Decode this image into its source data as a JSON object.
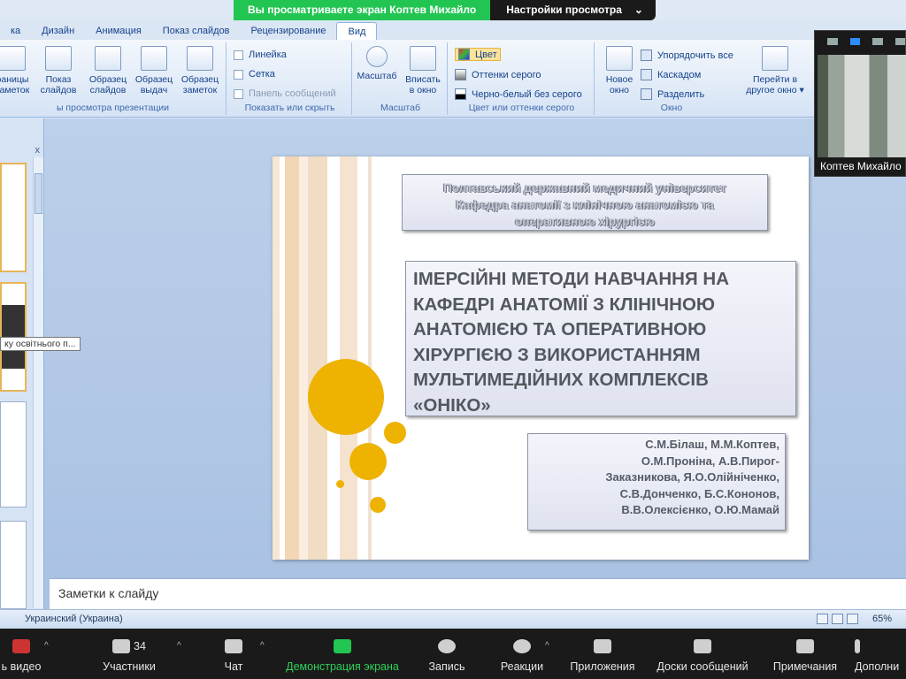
{
  "banner": {
    "message": "Вы просматриваете экран Коптев Михайло",
    "view_options": "Настройки просмотра",
    "view_options_chevron": "⌄"
  },
  "ribbon_tabs": [
    "ка",
    "Дизайн",
    "Анимация",
    "Показ слайдов",
    "Рецензирование",
    "Вид"
  ],
  "ribbon": {
    "presentation_views": {
      "buttons": [
        "раницы\nзаметок",
        "Показ\nслайдов",
        "Образец\nслайдов",
        "Образец\nвыдач",
        "Образец\nзаметок"
      ],
      "title": "ы просмотра презентации"
    },
    "show_hide": {
      "items": [
        "Линейка",
        "Сетка",
        "Панель сообщений"
      ],
      "title": "Показать или скрыть"
    },
    "zoom": {
      "buttons": [
        "Масштаб",
        "Вписать\nв окно"
      ],
      "title": "Масштаб"
    },
    "color": {
      "items": [
        "Цвет",
        "Оттенки серого",
        "Черно-белый без серого"
      ],
      "title": "Цвет или оттенки серого"
    },
    "window": {
      "new_window": "Новое\nокно",
      "items": [
        "Упорядочить все",
        "Каскадом",
        "Разделить"
      ],
      "switch": "Перейти в\nдругое окно ▾",
      "title": "Окно"
    }
  },
  "thumbs": {
    "close": "x",
    "tooltip": "ку освітнього п..."
  },
  "slide": {
    "university": "Полтавський державний медичний університет\nКафедра анатомії з клінічною анатомією та\nоперативною хірургією",
    "title": "ІМЕРСІЙНІ МЕТОДИ НАВЧАННЯ НА КАФЕДРІ АНАТОМІЇ З КЛІНІЧНОЮ АНАТОМІЄЮ ТА ОПЕРАТИВНОЮ ХІРУРГІЄЮ З ВИКОРИСТАННЯМ МУЛЬТИМЕДІЙНИХ КОМПЛЕКСІВ «ОНІКО»",
    "authors": "С.М.Білаш, М.М.Коптев,\nО.М.Проніна, А.В.Пирог-\nЗаказникова, Я.О.Олійніченко,\nС.В.Донченко, Б.С.Кононов,\nВ.В.Олексієнко, О.Ю.Мамай"
  },
  "notes_placeholder": "Заметки к слайду",
  "status": {
    "language": "Украинский (Украина)",
    "zoom": "65%"
  },
  "video": {
    "name": "Коптев Михайло"
  },
  "zoom_toolbar": {
    "video": "ь видео",
    "participants": "Участники",
    "participants_count": "34",
    "chat": "Чат",
    "share": "Демонстрация экрана",
    "record": "Запись",
    "reactions": "Реакции",
    "apps": "Приложения",
    "whiteboards": "Доски сообщений",
    "notes": "Примечания",
    "more": "Дополни"
  },
  "colors": {
    "share_green": "#23c552",
    "accent_circle": "#eeb200",
    "ribbon_text": "#15428b"
  }
}
